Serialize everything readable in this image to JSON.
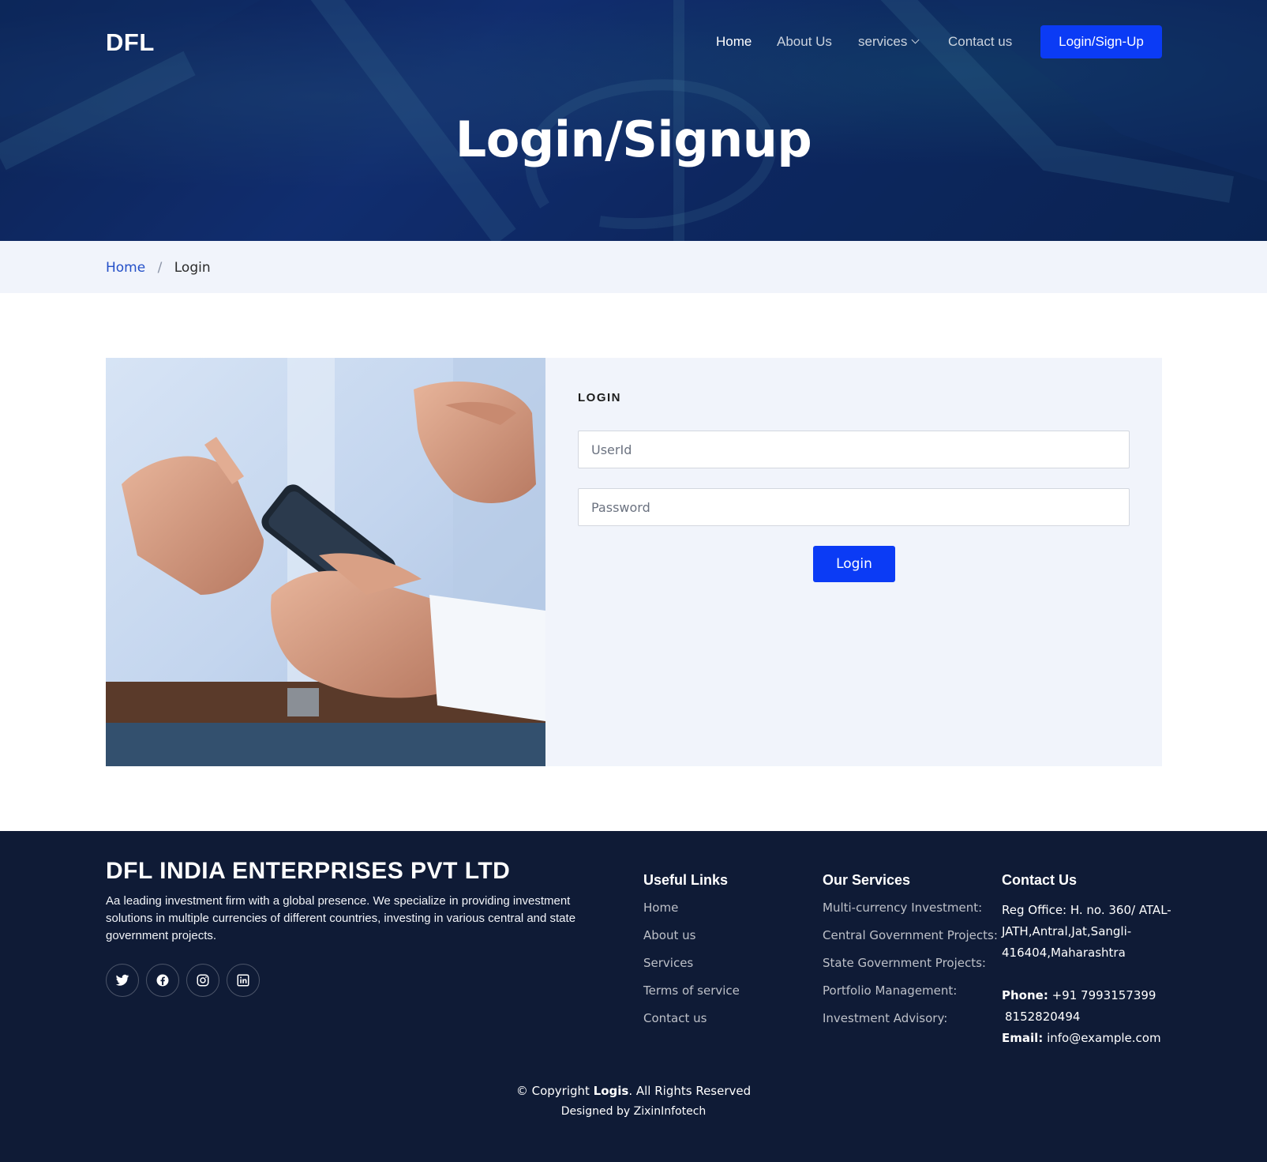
{
  "header": {
    "logo": "DFL",
    "nav": [
      {
        "label": "Home",
        "active": true
      },
      {
        "label": "About Us",
        "active": false
      },
      {
        "label": "services",
        "active": false,
        "has_dropdown": true
      },
      {
        "label": "Contact us",
        "active": false
      }
    ],
    "cta_label": "Login/Sign-Up",
    "page_title": "Login/Signup"
  },
  "breadcrumb": {
    "home": "Home",
    "separator": "/",
    "current": "Login"
  },
  "login_form": {
    "title": "LOGIN",
    "userid_placeholder": "UserId",
    "password_placeholder": "Password",
    "submit_label": "Login"
  },
  "footer": {
    "company": "DFL INDIA ENTERPRISES PVT LTD",
    "description": "Aa leading investment firm with a global presence. We specialize in providing investment solutions in multiple currencies of different countries, investing in various central and state government projects.",
    "social_icons": [
      "twitter-icon",
      "facebook-icon",
      "instagram-icon",
      "linkedin-icon"
    ],
    "useful_links": {
      "title": "Useful Links",
      "items": [
        "Home",
        "About us",
        "Services",
        "Terms of service",
        "Contact us"
      ]
    },
    "our_services": {
      "title": "Our Services",
      "items": [
        "Multi-currency Investment:",
        "Central Government Projects:",
        "State Government Projects:",
        "Portfolio Management:",
        "Investment Advisory:"
      ]
    },
    "contact": {
      "title": "Contact Us",
      "address_lines": [
        "Reg Office: H. no. 360/ ATAL-",
        "JATH,Antral,Jat,Sangli-",
        "416404,Maharashtra"
      ],
      "phone_label": "Phone:",
      "phone": "+91 7993157399",
      "phone2": "8152820494",
      "email_label": "Email:",
      "email": "info@example.com"
    },
    "copyright_prefix": "© Copyright",
    "copyright_brand": "Logis",
    "copyright_suffix": ". All Rights Reserved",
    "designed_by": "Designed by ZixinInfotech"
  },
  "colors": {
    "primary": "#0b3bf5",
    "footer_bg": "#0f1b36",
    "breadcrumb_bg": "#f1f4fb",
    "hero_bg": "#163a86"
  }
}
